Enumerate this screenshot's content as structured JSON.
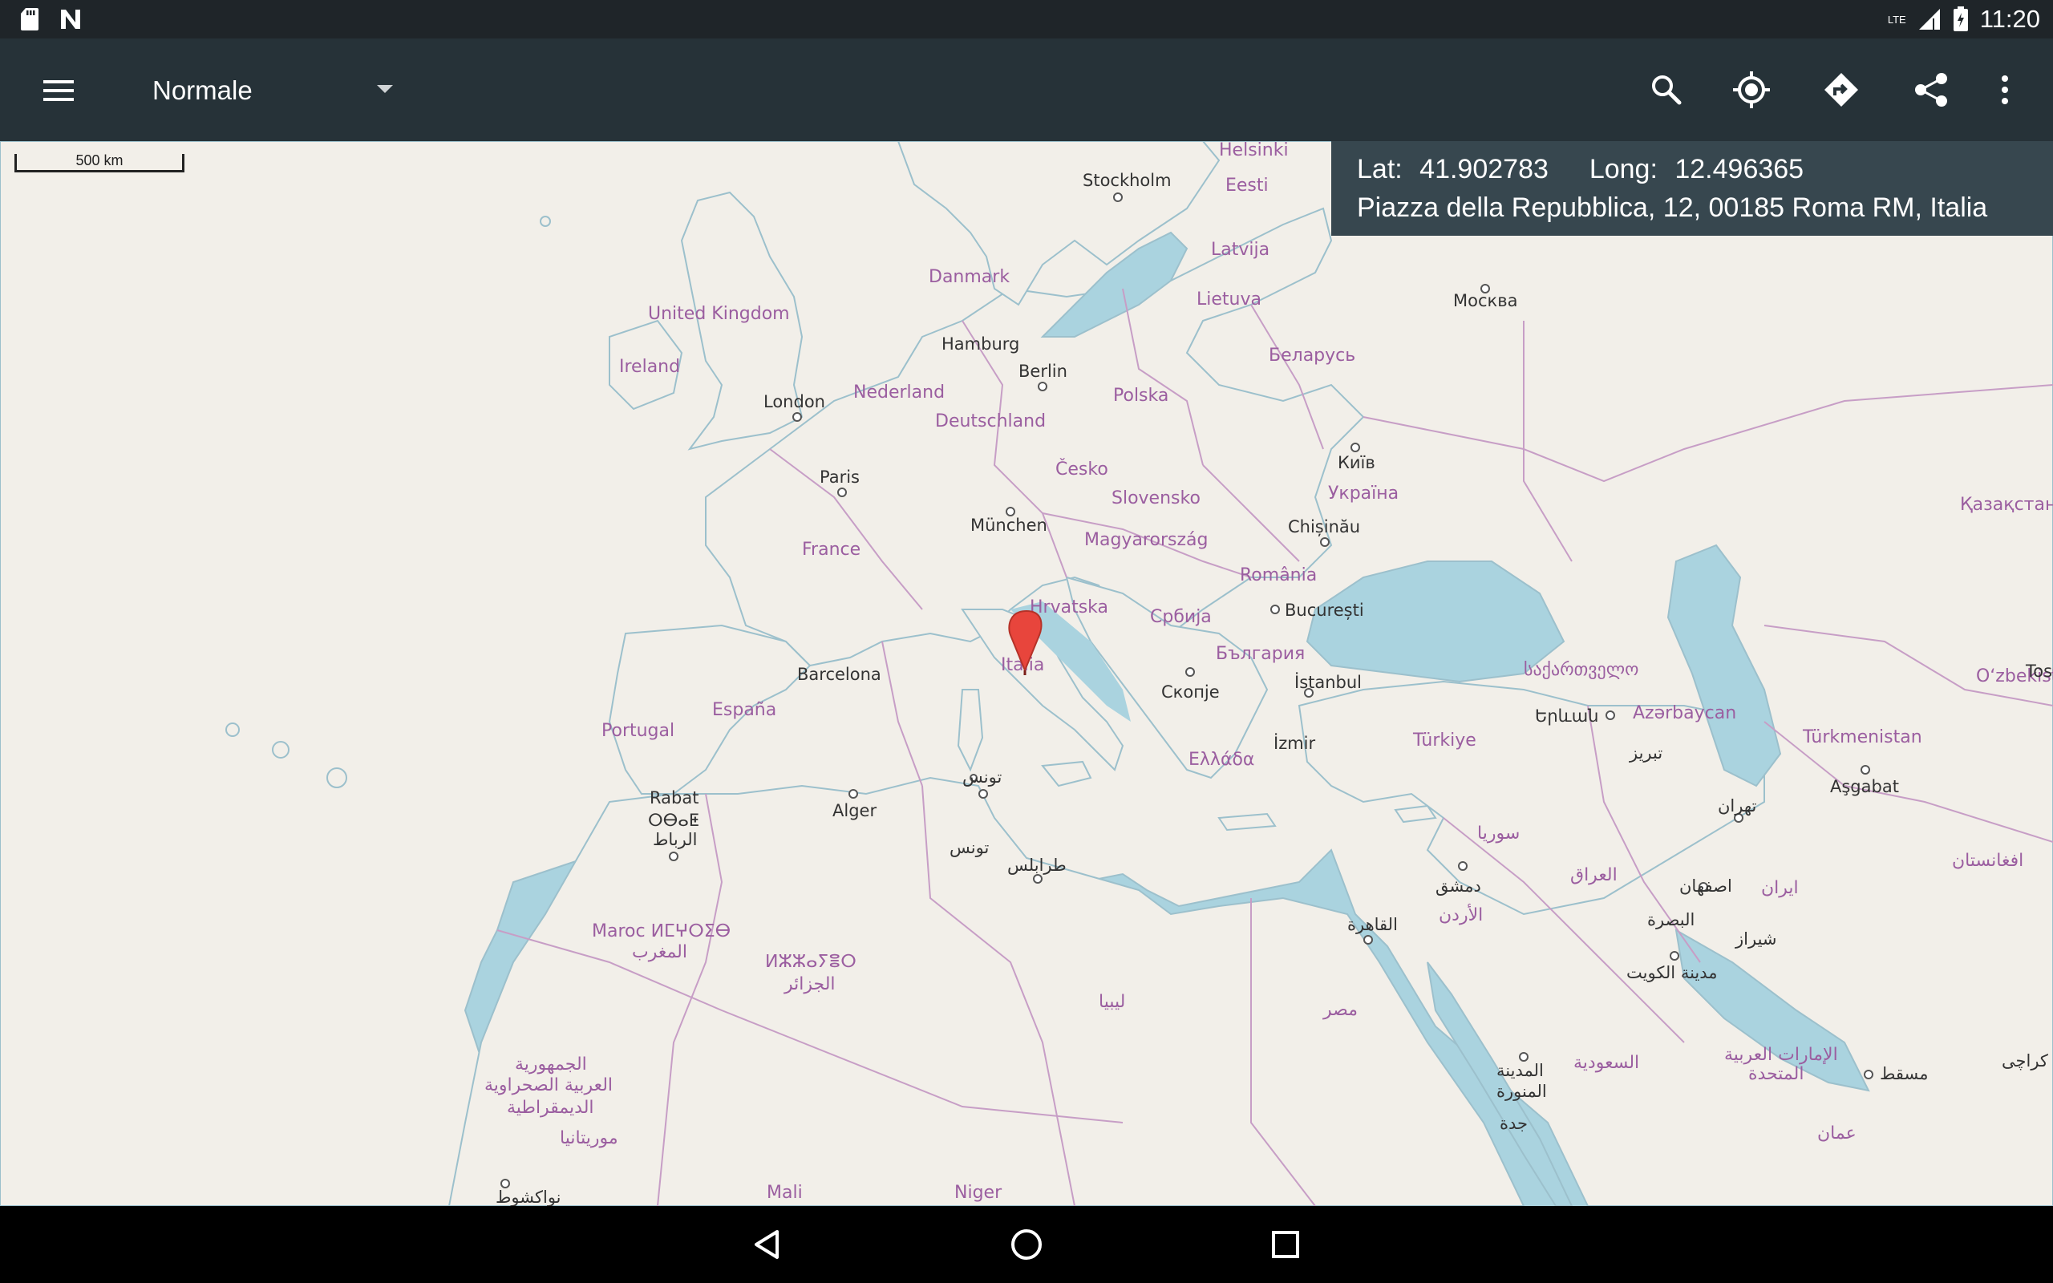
{
  "status_bar": {
    "clock": "11:20",
    "network": "LTE",
    "icons": [
      "sd-card-icon",
      "n-notification-icon",
      "signal-icon",
      "battery-icon"
    ]
  },
  "toolbar": {
    "map_type": "Normale",
    "icons": [
      "menu-icon",
      "search-icon",
      "my-location-icon",
      "directions-icon",
      "share-icon",
      "more-vert-icon"
    ]
  },
  "info_panel": {
    "lat_label": "Lat:",
    "lat_value": "41.902783",
    "long_label": "Long:",
    "long_value": "12.496365",
    "address": "Piazza della Repubblica, 12, 00185 Roma RM, Italia"
  },
  "map": {
    "scale_label": "500 km",
    "marker": "map-pin-icon",
    "colors": {
      "sea": "#aad3df",
      "land": "#f2efe9",
      "border": "#c79ec6",
      "marker": "#e8453c"
    },
    "countries": [
      "Helsinki",
      "Eesti",
      "Latvija",
      "Lietuva",
      "Danmark",
      "United Kingdom",
      "Ireland",
      "Nederland",
      "Deutschland",
      "Polska",
      "Беларусь",
      "Česko",
      "Slovensko",
      "Україна",
      "France",
      "Magyarország",
      "România",
      "Hrvatska",
      "Србија",
      "България",
      "Italia",
      "España",
      "Portugal",
      "Ελλάδα",
      "Türkiye",
      "საქართველო",
      "Azərbaycan",
      "Türkmenistan",
      "O‘zbekiston",
      "Қазақстан",
      "Maroc ⵍⵎⵖⵔⵉⴱ",
      "المغرب",
      "ⵍⵣⵣⴰⵢⴻⵔ",
      "الجزائر",
      "ليبيا",
      "مصر",
      "سوريا",
      "العراق",
      "الأردن",
      "السعودية",
      "ایران",
      "الإمارات العربية",
      "المتحدة",
      "عمان",
      "الجمهورية",
      "العربية الصحراوية",
      "الديمقراطية",
      "موريتانيا",
      "Mali",
      "Niger",
      "افغانستان"
    ],
    "cities": [
      "Stockholm",
      "Москва",
      "Hamburg",
      "Berlin",
      "London",
      "Paris",
      "Київ",
      "München",
      "Chișinău",
      "București",
      "Barcelona",
      "Скопје",
      "İstanbul",
      "Երևան",
      "İzmir",
      "Rabat",
      "ⵔⴱⴰⵟ",
      "الرباط",
      "Alger",
      "تونس",
      "طرابلس",
      "دمشق",
      "القاهرة",
      "تبریز",
      "تهران",
      "Aşgabat",
      "اصفهان",
      "البصرة",
      "مدينة الكويت",
      "شيراز",
      "المدينة",
      "المنورة",
      "جدة",
      "مسقط",
      "كراچى",
      "نواكشوط",
      "Tos"
    ]
  },
  "nav_bar": {
    "icons": [
      "back-icon",
      "home-icon",
      "recents-icon"
    ]
  }
}
